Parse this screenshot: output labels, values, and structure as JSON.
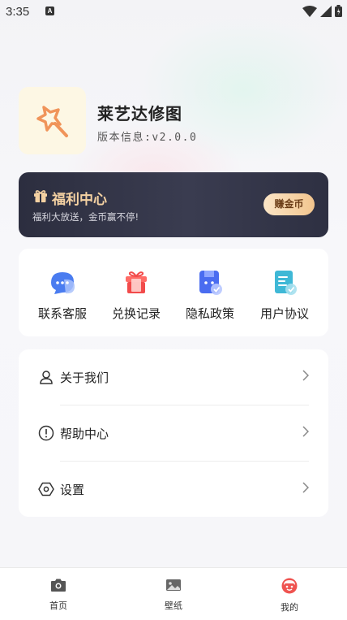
{
  "status_bar": {
    "time": "3:35",
    "notification_letter": "A"
  },
  "profile": {
    "app_name": "莱艺达修图",
    "version": "版本信息:v2.0.0"
  },
  "welfare": {
    "title": "福利中心",
    "subtitle": "福利大放送，金币赢不停!",
    "button": "赚金币"
  },
  "quick_actions": [
    {
      "label": "联系客服",
      "icon": "chat-icon"
    },
    {
      "label": "兑换记录",
      "icon": "gift-icon"
    },
    {
      "label": "隐私政策",
      "icon": "privacy-icon"
    },
    {
      "label": "用户协议",
      "icon": "document-icon"
    }
  ],
  "menu": [
    {
      "label": "关于我们",
      "icon": "user-icon"
    },
    {
      "label": "帮助中心",
      "icon": "help-icon"
    },
    {
      "label": "设置",
      "icon": "settings-icon"
    }
  ],
  "tabs": [
    {
      "label": "首页",
      "icon": "camera-icon"
    },
    {
      "label": "壁纸",
      "icon": "image-icon"
    },
    {
      "label": "我的",
      "icon": "profile-icon",
      "active": true
    }
  ],
  "colors": {
    "accent": "#ef5350",
    "banner_gold": "#f4d1a2",
    "banner_dark": "#2c2e3f"
  }
}
